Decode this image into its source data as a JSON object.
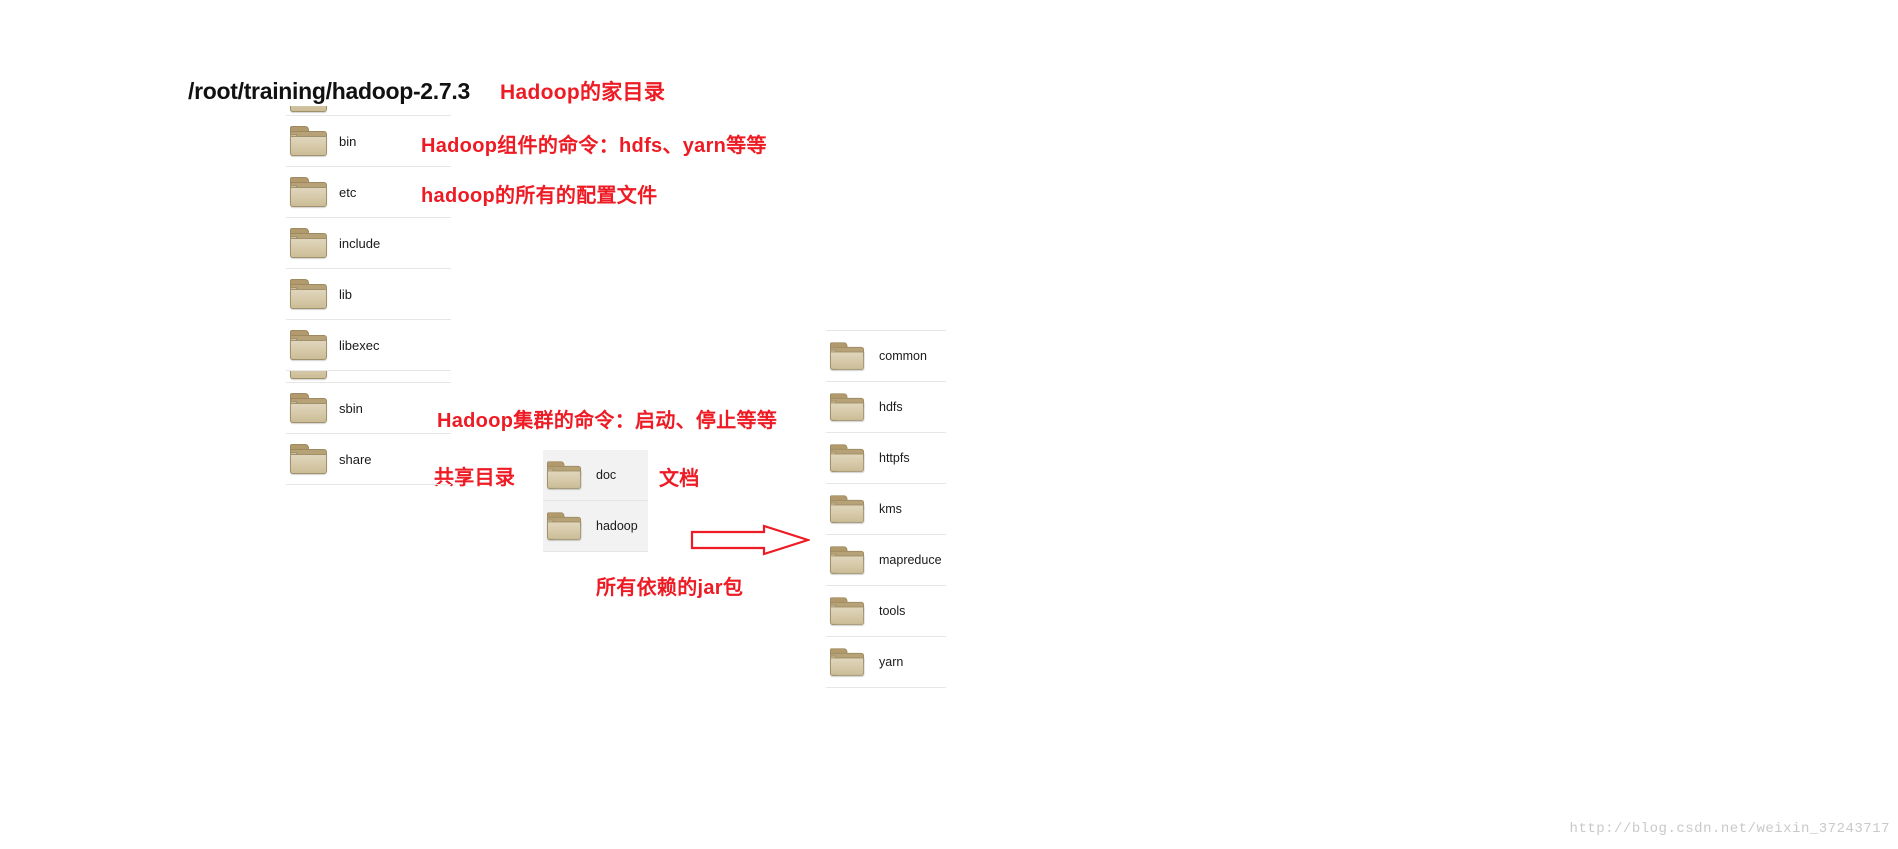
{
  "title": {
    "path": "/root/training/hadoop-2.7.3"
  },
  "annotations": {
    "home_dir": "Hadoop的家目录",
    "bin": "Hadoop组件的命令：hdfs、yarn等等",
    "etc": "hadoop的所有的配置文件",
    "sbin": "Hadoop集群的命令：启动、停止等等",
    "share": "共享目录",
    "doc": "文档",
    "jars": "所有依赖的jar包"
  },
  "columns": {
    "left": {
      "items": [
        {
          "name": "bin",
          "icon": "folder-icon"
        },
        {
          "name": "etc",
          "icon": "folder-icon"
        },
        {
          "name": "include",
          "icon": "folder-icon"
        },
        {
          "name": "lib",
          "icon": "folder-icon"
        },
        {
          "name": "libexec",
          "icon": "folder-icon"
        },
        {
          "name": "sbin",
          "icon": "folder-icon"
        },
        {
          "name": "share",
          "icon": "folder-icon"
        }
      ]
    },
    "middle": {
      "items": [
        {
          "name": "doc",
          "icon": "folder-icon"
        },
        {
          "name": "hadoop",
          "icon": "folder-icon"
        }
      ]
    },
    "right": {
      "items": [
        {
          "name": "common",
          "icon": "folder-icon"
        },
        {
          "name": "hdfs",
          "icon": "folder-icon"
        },
        {
          "name": "httpfs",
          "icon": "folder-icon"
        },
        {
          "name": "kms",
          "icon": "folder-icon"
        },
        {
          "name": "mapreduce",
          "icon": "folder-icon"
        },
        {
          "name": "tools",
          "icon": "folder-icon"
        },
        {
          "name": "yarn",
          "icon": "folder-icon"
        }
      ]
    }
  },
  "arrow": {
    "icon": "right-arrow-icon",
    "color": "#ee1b24"
  },
  "watermark": {
    "text": "http://blog.csdn.net/weixin_37243717"
  },
  "colors": {
    "annotation_red": "#ee1b24",
    "title_black": "#111111",
    "row_divider": "#e6e6e6",
    "folder_body": "#d6c9a8",
    "folder_tab": "#b29a6c",
    "watermark_gray": "#c9c9c9"
  }
}
